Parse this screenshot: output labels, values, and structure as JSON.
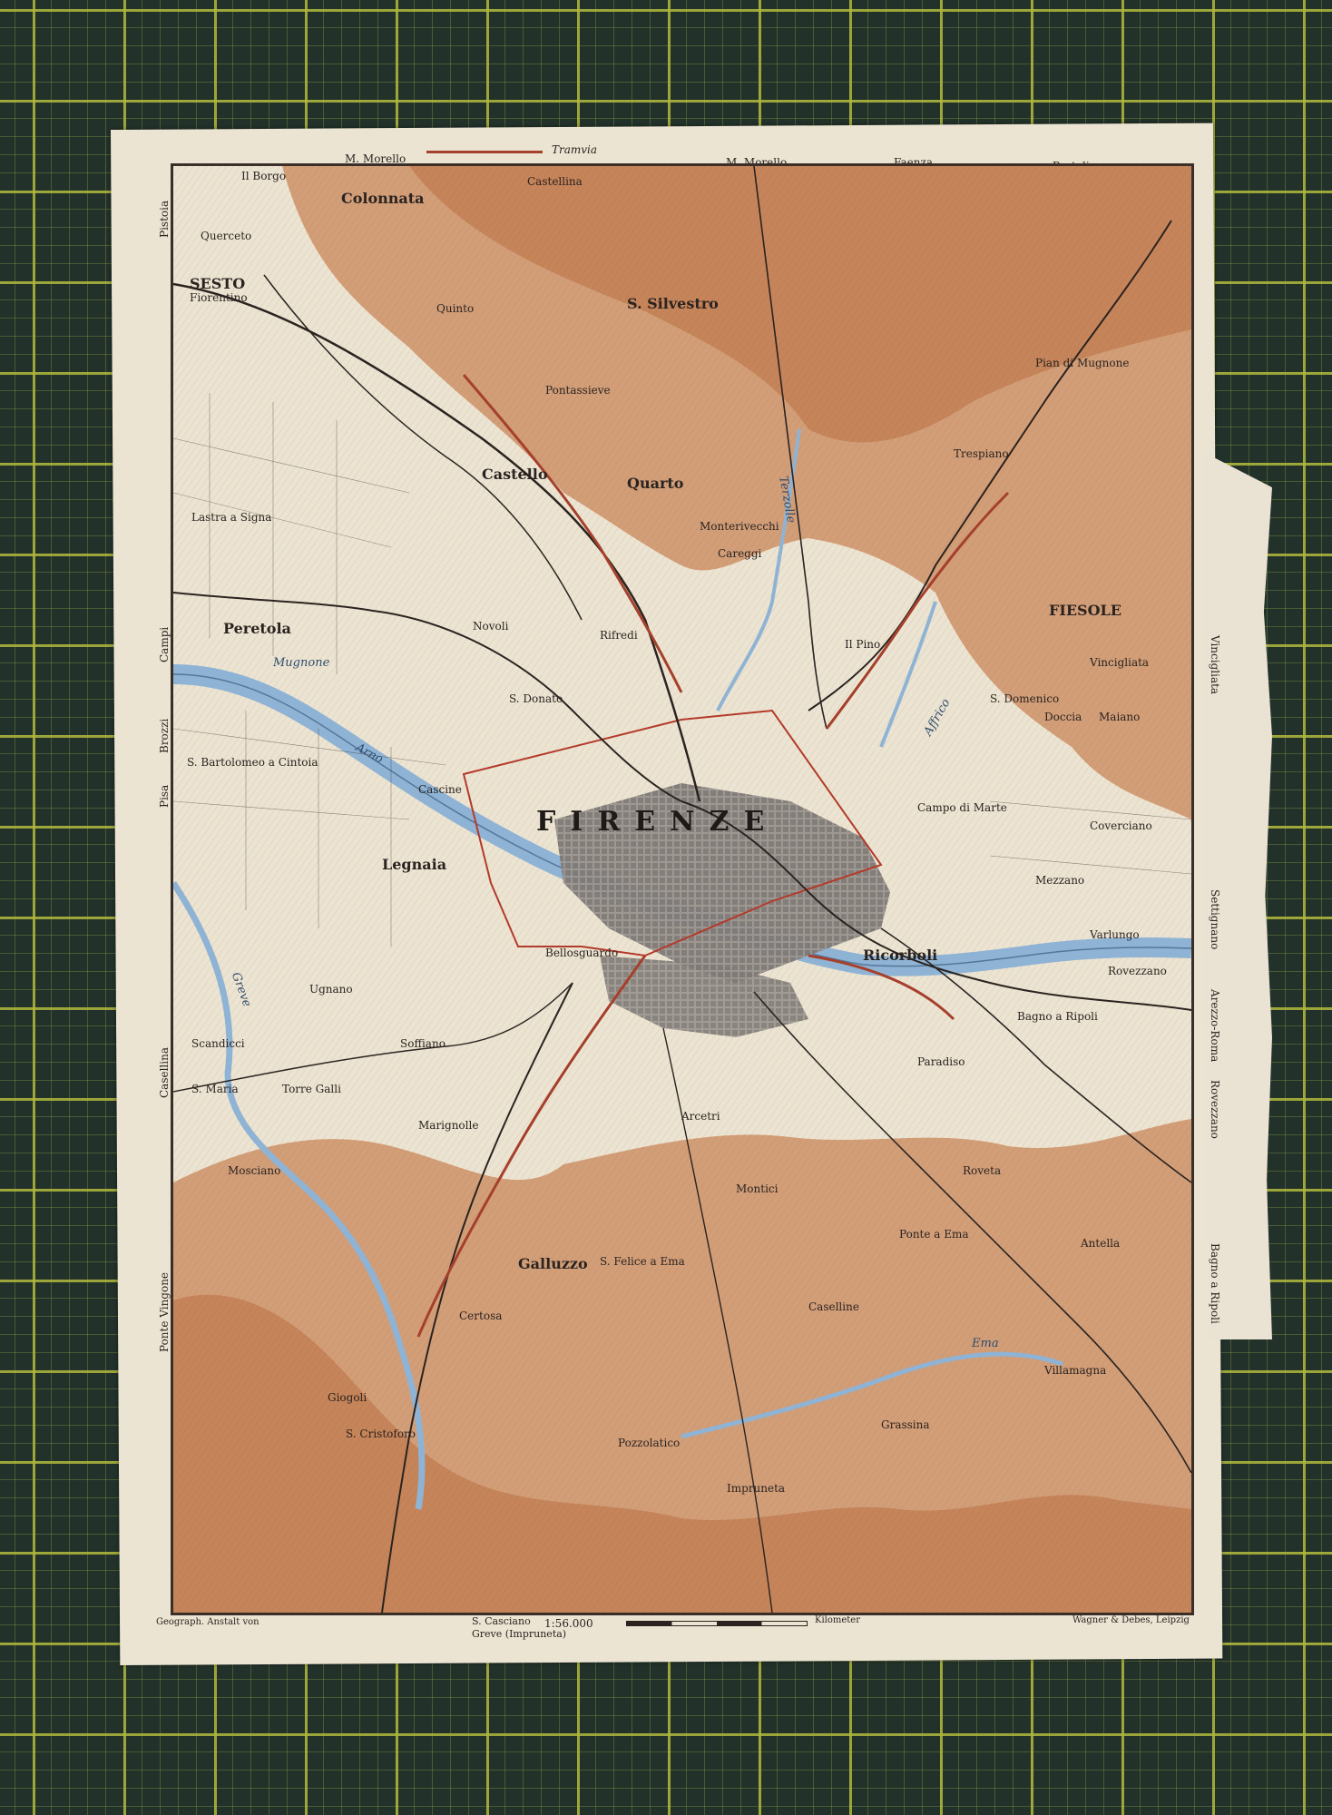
{
  "map": {
    "top_edge_labels": [
      "M. Morello",
      "M. Morello",
      "Faenza",
      "Pratolino"
    ],
    "legend_tramvia": "Tramvia",
    "left_edge_labels": [
      "Pistoia",
      "Campi",
      "Brozzi",
      "Pisa",
      "Casellina",
      "Ponte Vingone"
    ],
    "right_edge_labels": [
      "Vincigliata",
      "Settignano",
      "Arezzo-Roma",
      "Rovezzano",
      "Bagno a Ripoli"
    ],
    "footer": {
      "publisher_left": "Geograph. Anstalt von",
      "road_bottom_1": "S. Casciano",
      "road_bottom_2": "Greve (Impruneta)",
      "scale": "1:56.000",
      "scale_unit": "Kilometer",
      "publisher_right": "Wagner & Debes, Leipzig"
    },
    "main_city": "FIRENZE",
    "towns": [
      "Il Borgo",
      "Colonnata",
      "SESTO",
      "Fiorentino",
      "Querceto",
      "Castellina",
      "S. Silvestro",
      "Quarto",
      "Castello",
      "Careggi",
      "S. Domenico",
      "FIESOLE",
      "Peretola",
      "Pontassieve",
      "S. Bartolomeo a Cintoia",
      "Legnaia",
      "Scandicci",
      "S. Maria",
      "Galluzzo",
      "Certosa",
      "Giogoli",
      "S. Cristoforo",
      "Impruneta",
      "Paradiso",
      "Bagno a Ripoli",
      "Ricorboli",
      "Campo di Marte",
      "Coverciano",
      "Maiano",
      "Vincigliata",
      "Varlungo",
      "Rovezzano",
      "Trespiano",
      "Pian di Mugnone",
      "Monterivecchi",
      "S. Felice a Ema",
      "Pozzolatico",
      "Arcetri",
      "Bellosguardo",
      "Marignolle",
      "Soffiano",
      "Torre Galli",
      "Mosciano",
      "Roveta",
      "Caselline",
      "Il Pino",
      "Quinto",
      "Doccia",
      "Mezzano",
      "Lastra a Signa",
      "Cascine",
      "Novoli",
      "Rifredi",
      "S. Donato",
      "Villamagna",
      "Antella",
      "Montici",
      "Ponte a Ema",
      "Grassina",
      "Ugnano"
    ],
    "rivers": [
      "Arno",
      "Mugnone",
      "Greve",
      "Ema",
      "Terzolle",
      "Affrico"
    ],
    "colors": {
      "paper": "#ece4d2",
      "hills": "#c9875a",
      "river": "#8fb3d4",
      "tram": "#a5402c",
      "ink": "#2a2320",
      "board": "#22312a",
      "grid": "#b0b83c"
    }
  }
}
